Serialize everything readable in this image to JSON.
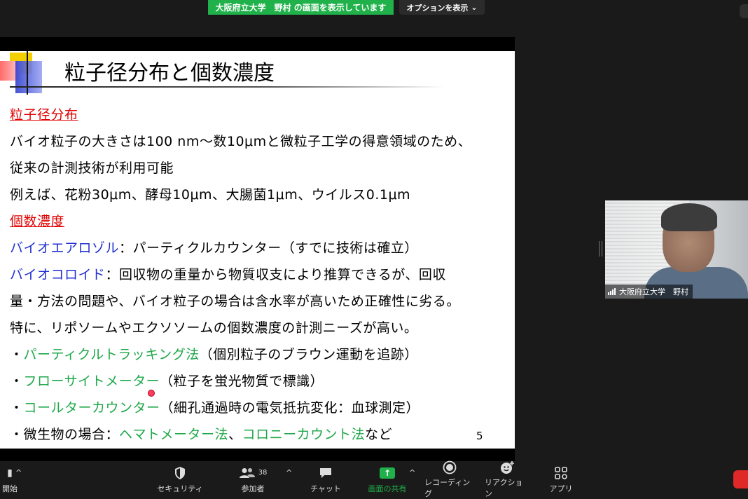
{
  "top": {
    "share_banner": "大阪府立大学　野村 の画面を表示しています",
    "view_options": "オプションを表示",
    "view_options_caret": "⌄"
  },
  "slide": {
    "title": "粒子径分布と個数濃度",
    "section1": "粒子径分布",
    "line1": "バイオ粒子の大きさは100 nm〜数10μmと微粒子工学の得意領域のため、",
    "line2": "従来の計測技術が利用可能",
    "line3": "例えば、花粉30μm、酵母10μm、大腸菌1μm、ウイルス0.1μm",
    "section2": "個数濃度",
    "aerosol_label": "バイオエアロゾル",
    "aerosol_text": "：パーティクルカウンター（すでに技術は確立）",
    "colloid_label": "バイオコロイド",
    "colloid_text": "：回収物の重量から物質収支により推算できるが、回収",
    "line_colloid2": "量・方法の問題や、バイオ粒子の場合は含水率が高いため正確性に劣る。",
    "line_special": "特に、リポソームやエクソソームの個数濃度の計測ニーズが高い。",
    "bullet": "・",
    "b1_label": "パーティクルトラッキング法",
    "b1_text": "（個別粒子のブラウン運動を追跡）",
    "b2_label": "フローサイトメーター",
    "b2_text": "（粒子を蛍光物質で標識）",
    "b3_label": "コールターカウンター",
    "b3_text": "（細孔通過時の電気抵抗変化：血球測定）",
    "b4_prefix": "微生物の場合：",
    "b4_green1": "ヘマトメーター法",
    "b4_sep": "、",
    "b4_green2": "コロニーカウント法",
    "b4_suffix": "など",
    "page_number": "5"
  },
  "video": {
    "name": "大阪府立大学　野村"
  },
  "toolbar": {
    "start": "開始",
    "security": "セキュリティ",
    "participants": "参加者",
    "participants_count": "38",
    "chat": "チャット",
    "share_screen": "画面の共有",
    "recording": "レコーディング",
    "reactions": "リアクション",
    "apps": "アプリ",
    "caret": "^"
  },
  "colors": {
    "share_green": "#20b14a",
    "slide_red": "#e00000",
    "slide_blue": "#1f2fd0",
    "slide_green": "#1fa84a",
    "end_red": "#e02828"
  },
  "icons": [
    "shield-icon",
    "participants-icon",
    "chat-icon",
    "share-screen-icon",
    "record-icon",
    "reaction-icon",
    "apps-icon",
    "signal-icon"
  ]
}
